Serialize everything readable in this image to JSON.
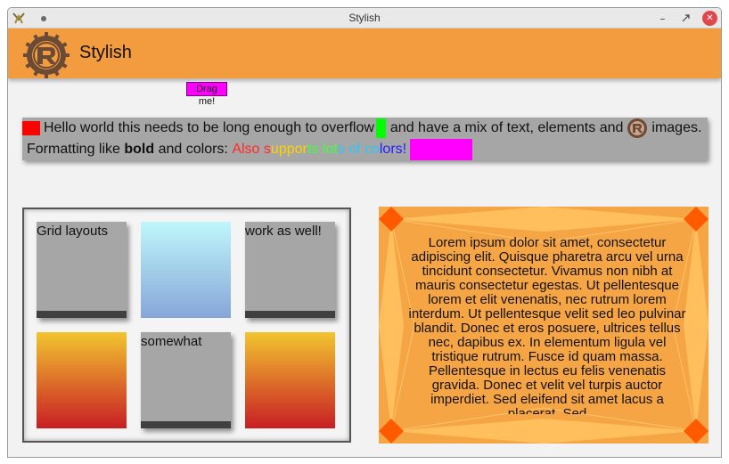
{
  "window": {
    "title": "Stylish"
  },
  "header": {
    "title": "Stylish"
  },
  "drag": {
    "label": "Drag me!"
  },
  "flow": {
    "text1": "Hello world this needs to be long enough to overflow",
    "text2": "and have a mix of text, elements and",
    "text3": "images.",
    "text4": "Formatting like",
    "bold": "bold",
    "text5": "and colors:",
    "rainbow": [
      "Also",
      "supports",
      "lots",
      "of",
      "colors!"
    ],
    "rainbow_colors": [
      "#ff2a2a",
      "#ffd200",
      "#3fff3f",
      "#28c8ff",
      "#2020ff",
      "#9b1fd0",
      "#ff2a2a"
    ]
  },
  "grid": {
    "cell1_label": "Grid layouts",
    "cell3_label": "work as well!",
    "cell5_label": "somewhat"
  },
  "lorem": {
    "text": "Lorem ipsum dolor sit amet, consectetur adipiscing elit. Quisque pharetra arcu vel urna tincidunt consectetur. Vivamus non nibh at mauris consectetur egestas. Ut pellentesque lorem et elit venenatis, nec rutrum lorem interdum. Ut pellentesque velit sed leo pulvinar blandit. Donec et eros posuere, ultrices tellus nec, dapibus ex. In elementum ligula vel tristique rutrum. Fusce id quam massa. Pellentesque in lectus eu felis venenatis gravida. Donec et velit vel turpis auctor imperdiet. Sed eleifend sit amet lacus a placerat. Sed"
  },
  "colors": {
    "header": "#f29b3f",
    "magenta": "#ff00ff",
    "red": "#ff0000",
    "green": "#00ff00",
    "corner_diamond": "#ff5a00"
  }
}
